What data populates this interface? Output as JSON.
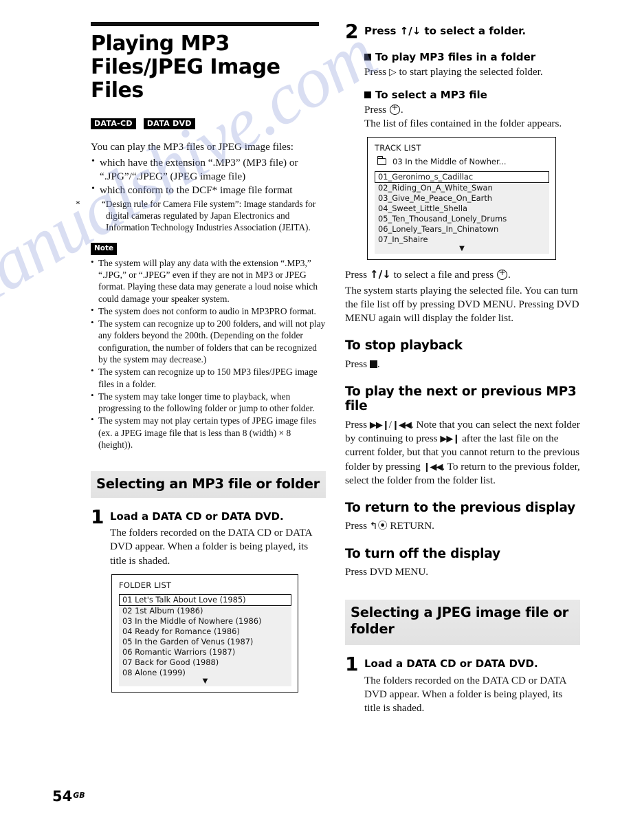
{
  "document": {
    "page_number": "54",
    "page_suffix": "GB"
  },
  "watermark": "manualshive.com",
  "left_column": {
    "title": "Playing MP3 Files/JPEG Image Files",
    "badges": [
      "DATA-CD",
      "DATA DVD"
    ],
    "intro": "You can play the MP3 files or JPEG image files:",
    "bullets": [
      "which have the extension “.MP3” (MP3 file) or “.JPG”/“.JPEG” (JPEG image file)",
      "which conform to the DCF* image file format"
    ],
    "footnote": "“Design rule for Camera File system”: Image standards for digital cameras regulated by Japan Electronics and Information Technology Industries Association (JEITA).",
    "footnote_marker": "*",
    "note_label": "Note",
    "notes": [
      "The system will play any data with the extension “.MP3,” “.JPG,” or “.JPEG” even if they are not in MP3 or JPEG format. Playing these data may generate a loud noise which could damage your speaker system.",
      "The system does not conform to audio in MP3PRO format.",
      "The system can recognize up to 200 folders, and will not play any folders beyond the 200th. (Depending on the folder configuration, the number of folders that can be recognized by the system may decrease.)",
      "The system can recognize up to 150 MP3 files/JPEG image files in a folder.",
      "The system may take longer time to playback, when progressing to the following folder or jump to other folder.",
      "The system may not play certain types of JPEG image files (ex. a JPEG image file that is less than 8 (width) × 8 (height))."
    ],
    "section_heading": "Selecting an MP3 file or folder",
    "step1": {
      "number": "1",
      "title": "Load a DATA CD or DATA DVD.",
      "text": "The folders recorded on the DATA CD or DATA DVD appear. When a folder is being played, its title is shaded."
    },
    "folder_list": {
      "title": "FOLDER LIST",
      "items": [
        "01  Let's Talk About Love (1985)",
        "02  1st Album (1986)",
        "03  In the Middle of Nowhere (1986)",
        "04  Ready for Romance (1986)",
        "05  In the Garden of Venus (1987)",
        "06  Romantic Warriors (1987)",
        "07  Back for Good (1988)",
        "08  Alone (1999)"
      ],
      "selected_index": 0,
      "scroll_caret": "▼"
    }
  },
  "right_column": {
    "step2": {
      "number": "2",
      "title_pre": "Press ",
      "title_arrows": "↑/↓",
      "title_post": " to select a folder."
    },
    "sub1": {
      "heading": "To play MP3 files in a folder",
      "text_pre": "Press ",
      "icon": "play-icon",
      "text_post": " to start playing the selected folder."
    },
    "sub2": {
      "heading": "To select a MP3 file",
      "text_pre": "Press ",
      "icon": "enter-icon",
      "text_post": ".",
      "text_next": "The list of files contained in the folder appears."
    },
    "track_list": {
      "title": "TRACK LIST",
      "folder_row": "03  In the Middle of Nowher...",
      "items": [
        "01_Geronimo_s_Cadillac",
        "02_Riding_On_A_White_Swan",
        "03_Give_Me_Peace_On_Earth",
        "04_Sweet_Little_Shella",
        "05_Ten_Thousand_Lonely_Drums",
        "06_Lonely_Tears_In_Chinatown",
        "07_In_Shaire"
      ],
      "selected_index": 0,
      "scroll_caret": "▼"
    },
    "after_track_list": {
      "line1_pre": "Press ",
      "line1_arrows": "↑/↓",
      "line1_mid": " to select a file and press ",
      "line1_post": ".",
      "paragraph": "The system starts playing the selected file. You can turn the file list off by pressing DVD MENU. Pressing DVD MENU again will display the folder list."
    },
    "stop": {
      "heading": "To stop playback",
      "text_pre": "Press ",
      "icon": "stop-icon",
      "text_post": "."
    },
    "nextprev": {
      "heading": "To play the next or previous MP3 file",
      "seg1": "Press ",
      "icon_next": "▶▶❙",
      "seg2": "/",
      "icon_prev": "❙◀◀",
      "seg3": ". Note that you can select the next folder by continuing to press ",
      "icon_next2": "▶▶❙",
      "seg4": " after the last file on the current folder, but that you cannot return to the previous folder by pressing ",
      "icon_prev2": "❙◀◀",
      "seg5": ". To return to the previous folder, select the folder from the folder list."
    },
    "return_display": {
      "heading": "To return to the previous display",
      "text_pre": "Press ",
      "icon": "return-icon",
      "text_post": " RETURN."
    },
    "turn_off": {
      "heading": "To turn off the display",
      "text": "Press DVD MENU."
    },
    "section_heading": "Selecting a JPEG image file or folder",
    "step1": {
      "number": "1",
      "title": "Load a DATA CD or DATA DVD.",
      "text": "The folders recorded on the DATA CD or DATA DVD appear. When a folder is being played, its title is shaded."
    }
  }
}
